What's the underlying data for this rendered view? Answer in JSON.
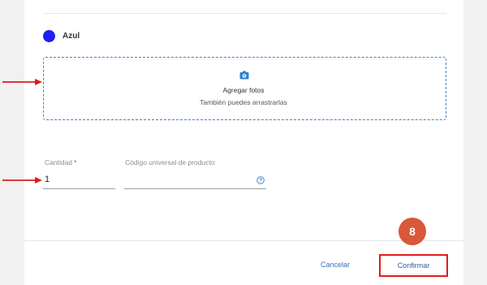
{
  "variant": {
    "color_name": "Azul",
    "swatch_color": "#1f1ff2"
  },
  "photos": {
    "title": "Agregar fotos",
    "subtitle": "También puedes arrastrarlas",
    "icon": "camera-icon"
  },
  "fields": {
    "quantity_label": "Cantidad",
    "quantity_required": "*",
    "quantity_value": "1",
    "upc_label": "Código universal de producto",
    "help_icon": "question-circle-icon"
  },
  "footer": {
    "cancel_label": "Cancelar",
    "confirm_label": "Confirmar"
  },
  "annotations": {
    "step_number": "8",
    "badge_color": "#d9573a",
    "highlight_color": "#e01b1b"
  }
}
